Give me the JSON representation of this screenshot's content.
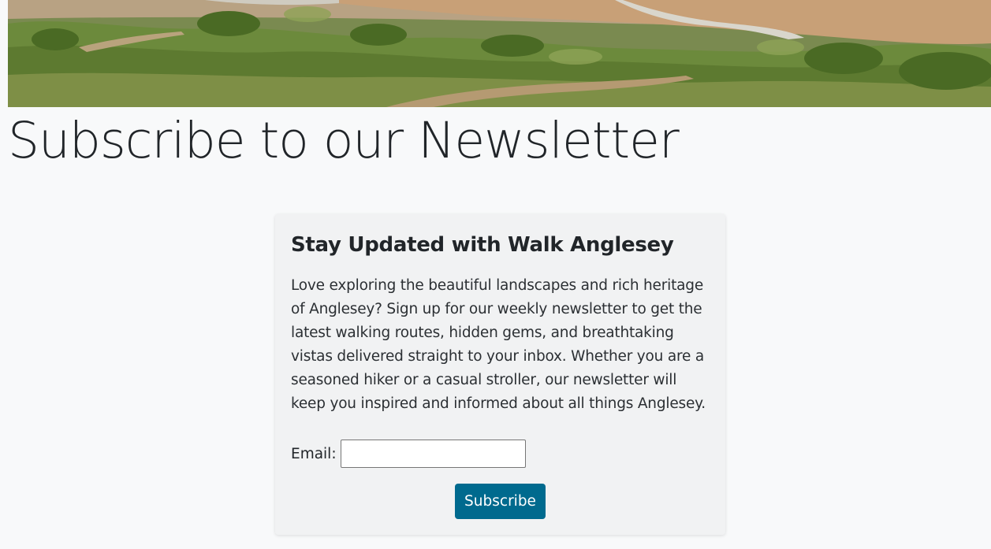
{
  "hero": {
    "alt": "Anglesey coastal landscape"
  },
  "page": {
    "title": "Subscribe to our Newsletter"
  },
  "card": {
    "title": "Stay Updated with Walk Anglesey",
    "body": "Love exploring the beautiful landscapes and rich heritage of Anglesey? Sign up for our weekly newsletter to get the latest walking routes, hidden gems, and breathtaking vistas delivered straight to your inbox. Whether you are a seasoned hiker or a casual stroller, our newsletter will keep you inspired and informed about all things Anglesey."
  },
  "form": {
    "email_label": "Email:",
    "email_value": "",
    "subscribe_label": "Subscribe"
  },
  "colors": {
    "background": "#f8f9fa",
    "card": "#f1f2f3",
    "button": "#006a8e",
    "text": "#212529"
  }
}
